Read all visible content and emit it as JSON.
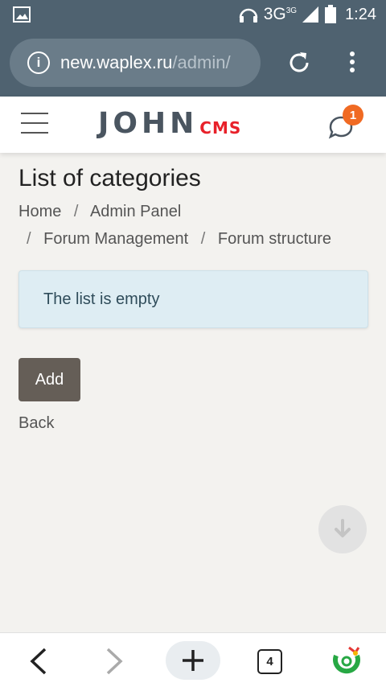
{
  "statusbar": {
    "network": "3G",
    "network_sup": "3G",
    "time": "1:24"
  },
  "browser": {
    "url_host": "new.waplex.ru",
    "url_path": "/admin/"
  },
  "header": {
    "logo_main": "JOHN",
    "logo_sub": "CMS",
    "notification_count": "1"
  },
  "page": {
    "title": "List of categories",
    "breadcrumb": {
      "home": "Home",
      "sep": "/",
      "admin_panel": "Admin Panel",
      "forum_management": "Forum Management",
      "forum_structure": "Forum structure"
    },
    "alert_text": "The list is empty",
    "add_button": "Add",
    "back_link": "Back"
  },
  "bottomnav": {
    "tab_count": "4"
  },
  "colors": {
    "statusbar": "#4f6270",
    "logo_red": "#e8212a",
    "badge": "#f06a23",
    "alert_bg": "#deedf3",
    "add_button": "#655e57"
  }
}
